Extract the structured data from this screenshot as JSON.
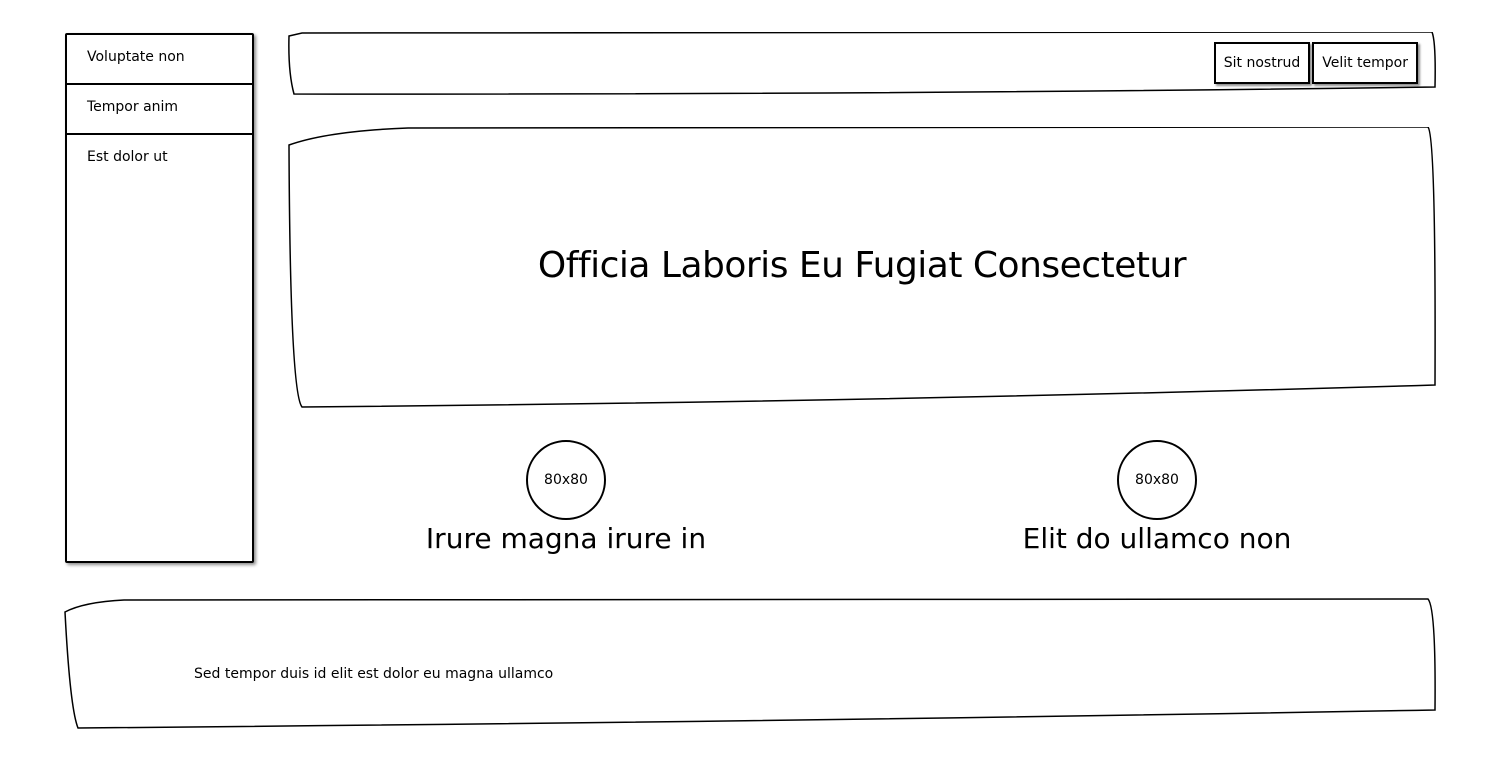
{
  "sidebar": {
    "items": [
      {
        "label": "Voluptate non"
      },
      {
        "label": "Tempor anim"
      },
      {
        "label": "Est dolor ut"
      }
    ]
  },
  "header": {
    "buttons": [
      {
        "label": "Sit nostrud"
      },
      {
        "label": "Velit tempor"
      }
    ]
  },
  "hero": {
    "title": "Officia Laboris Eu Fugiat Consectetur"
  },
  "features": [
    {
      "image_label": "80x80",
      "title": "Irure magna irure in"
    },
    {
      "image_label": "80x80",
      "title": "Elit do ullamco non"
    }
  ],
  "footer": {
    "text": "Sed tempor duis id elit est dolor eu magna ullamco"
  }
}
